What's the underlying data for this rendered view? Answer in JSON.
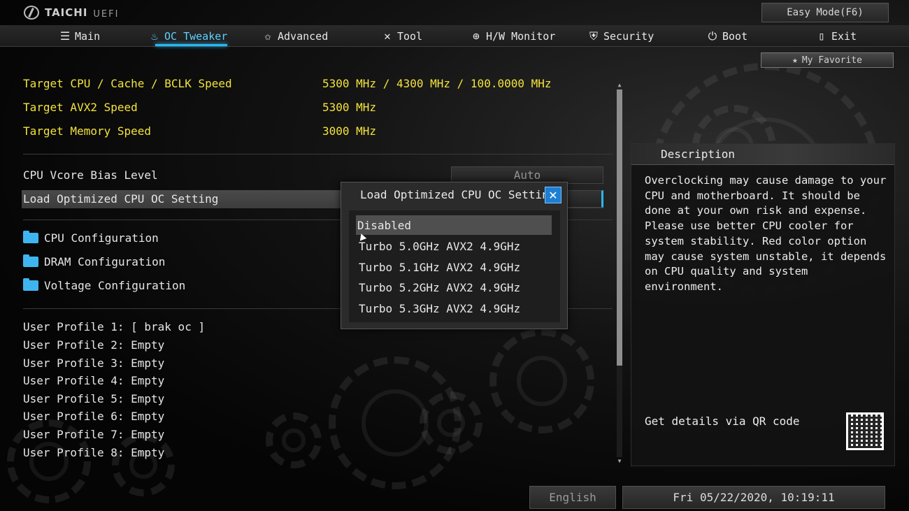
{
  "brand": {
    "name": "TAICHI",
    "sub": "UEFI"
  },
  "header": {
    "easy_mode_label": "Easy Mode(F6)"
  },
  "nav": {
    "items": [
      {
        "label": "Main",
        "icon": "list-icon"
      },
      {
        "label": "OC Tweaker",
        "icon": "flame-icon"
      },
      {
        "label": "Advanced",
        "icon": "star-icon"
      },
      {
        "label": "Tool",
        "icon": "tools-icon"
      },
      {
        "label": "H/W Monitor",
        "icon": "crosshair-icon"
      },
      {
        "label": "Security",
        "icon": "shield-icon"
      },
      {
        "label": "Boot",
        "icon": "power-icon"
      },
      {
        "label": "Exit",
        "icon": "exit-door-icon"
      }
    ],
    "active": "OC Tweaker"
  },
  "favorite": {
    "label": "My Favorite",
    "icon": "star-icon"
  },
  "targets": [
    {
      "label": "Target CPU / Cache / BCLK Speed",
      "value": "5300 MHz / 4300 MHz / 100.0000 MHz"
    },
    {
      "label": "Target AVX2 Speed",
      "value": "5300 MHz"
    },
    {
      "label": "Target Memory Speed",
      "value": "3000 MHz"
    }
  ],
  "settings": [
    {
      "label": "CPU Vcore Bias Level",
      "value": "Auto"
    },
    {
      "label": "Load Optimized CPU OC Setting",
      "value": "Disabled"
    }
  ],
  "submenus": [
    {
      "label": "CPU Configuration"
    },
    {
      "label": "DRAM Configuration"
    },
    {
      "label": "Voltage Configuration"
    }
  ],
  "profiles": [
    "User Profile 1: [ brak oc ]",
    "User Profile 2: Empty",
    "User Profile 3: Empty",
    "User Profile 4: Empty",
    "User Profile 5: Empty",
    "User Profile 6: Empty",
    "User Profile 7: Empty",
    "User Profile 8: Empty"
  ],
  "scrollbar": {
    "visible_fraction": 0.75
  },
  "description": {
    "title": "Description",
    "text": "Overclocking may cause damage to your\nCPU and motherboard. It should be\ndone at your own risk and expense.\nPlease use better CPU cooler for\nsystem stability. Red color option\nmay cause system unstable, it depends\non CPU quality and system environment.",
    "qr_label": "Get details via QR code"
  },
  "popup": {
    "title": "Load Optimized CPU OC Setting",
    "close_glyph": "✕",
    "options": [
      "Disabled",
      "Turbo 5.0GHz AVX2 4.9GHz",
      "Turbo 5.1GHz AVX2 4.9GHz",
      "Turbo 5.2GHz AVX2 4.9GHz",
      "Turbo 5.3GHz AVX2 4.9GHz"
    ],
    "selected": "Disabled"
  },
  "footer": {
    "language": "English",
    "datetime": "Fri 05/22/2020, 10:19:11"
  }
}
